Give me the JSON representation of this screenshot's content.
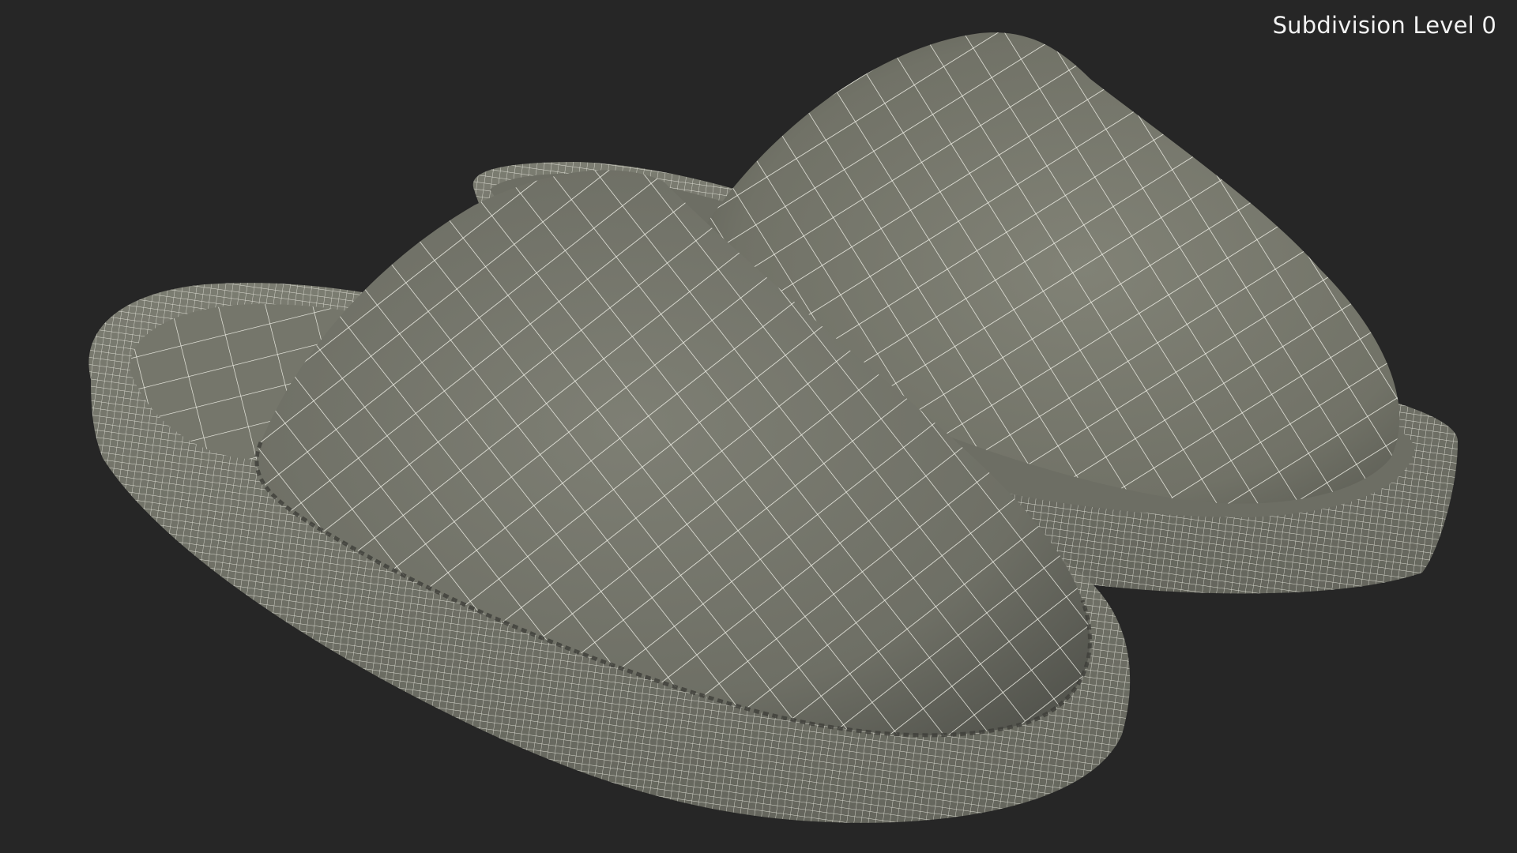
{
  "viewport": {
    "caption": "Subdivision Level 0"
  },
  "render": {
    "background_color": "#262626",
    "surface_color": "#7c7d72",
    "wire_color": "#f3f3ea",
    "models": [
      "slipper-left",
      "slipper-right"
    ]
  }
}
